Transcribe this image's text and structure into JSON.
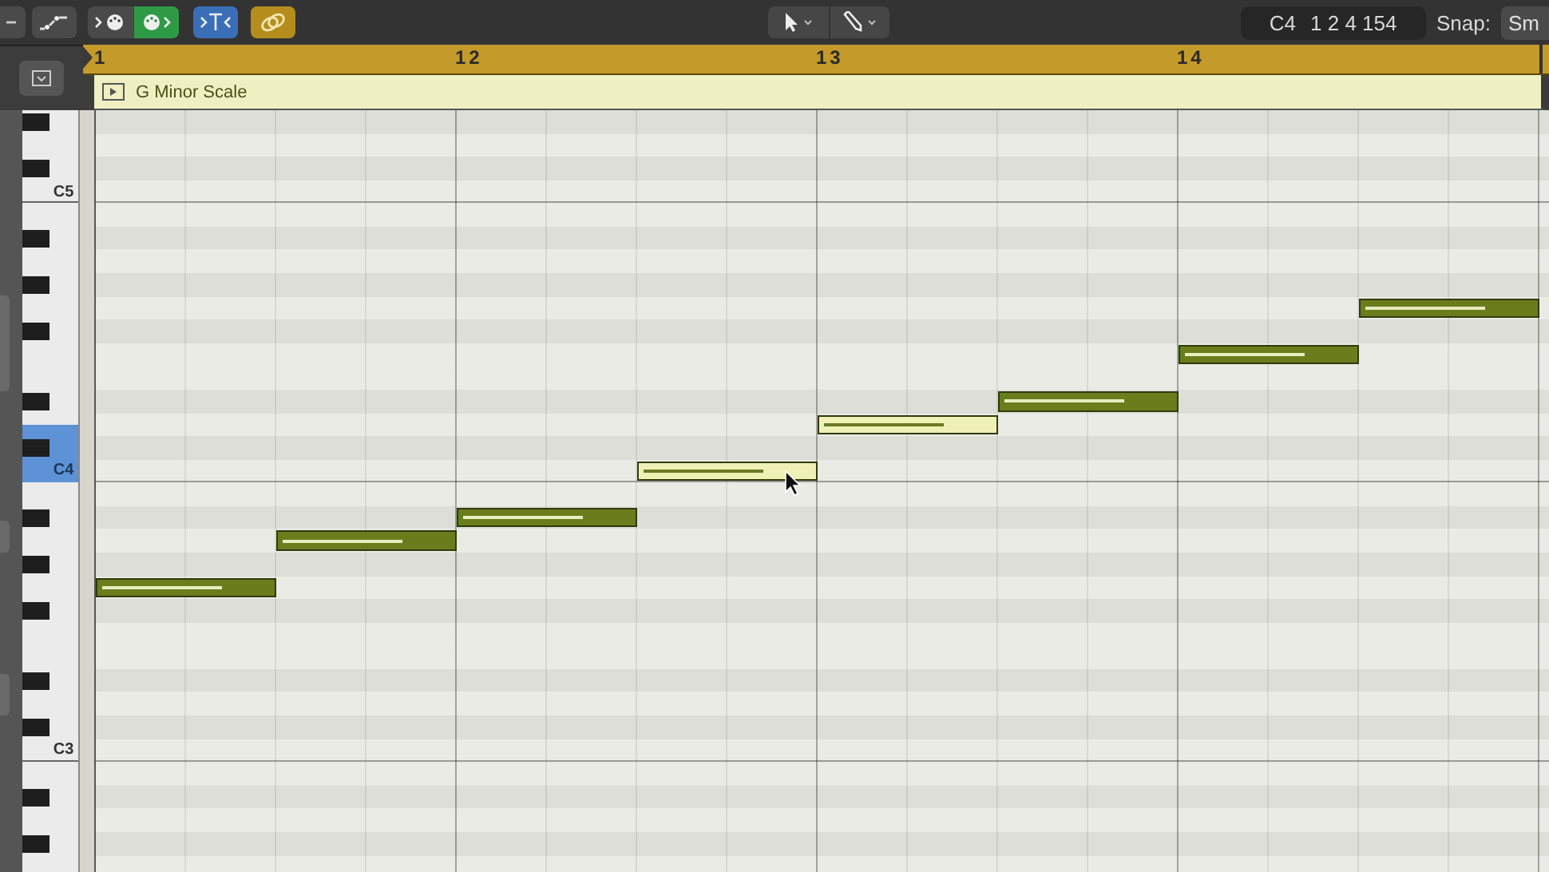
{
  "toolbar": {
    "midi_in_on": false,
    "midi_out_on": true,
    "catch_on": true,
    "link_on": true,
    "position": {
      "pitch": "C4",
      "time": "1 2 4 154"
    },
    "snap": {
      "label": "Snap:",
      "value": "Sm"
    }
  },
  "ruler": {
    "bars": [
      "1",
      "12",
      "13",
      "14"
    ]
  },
  "region": {
    "name": "G Minor Scale"
  },
  "keyboard": {
    "octave_labels": [
      {
        "label": "C5",
        "selected": false
      },
      {
        "label": "C4",
        "selected": true
      },
      {
        "label": "C3",
        "selected": false
      }
    ]
  },
  "notes": [
    {
      "selected": false
    },
    {
      "selected": false
    },
    {
      "selected": false
    },
    {
      "selected": true
    },
    {
      "selected": true
    },
    {
      "selected": false
    },
    {
      "selected": false
    },
    {
      "selected": false
    }
  ]
}
